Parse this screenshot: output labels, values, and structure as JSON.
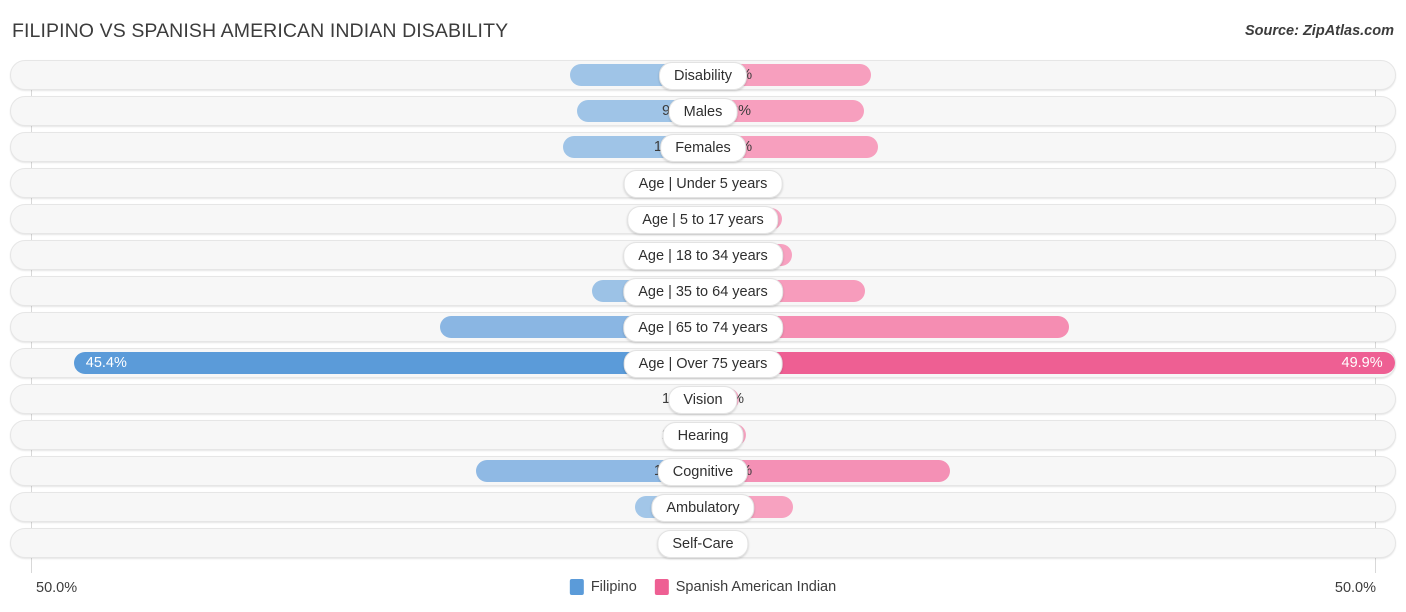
{
  "header": {
    "title": "FILIPINO VS SPANISH AMERICAN INDIAN DISABILITY",
    "source": "Source: ZipAtlas.com"
  },
  "axis": {
    "left_label": "50.0%",
    "right_label": "50.0%"
  },
  "legend": {
    "items": [
      {
        "label": "Filipino",
        "color": "#5b9bd9"
      },
      {
        "label": "Spanish American Indian",
        "color": "#ee5f93"
      }
    ]
  },
  "chart_data": {
    "type": "bar",
    "title": "FILIPINO VS SPANISH AMERICAN INDIAN DISABILITY",
    "subtitle": "Source: ZipAtlas.com",
    "orientation": "horizontal-diverging",
    "xlabel": "",
    "ylabel": "",
    "xlim": [
      -50.0,
      50.0
    ],
    "axis_left_label": "50.0%",
    "axis_right_label": "50.0%",
    "grid": true,
    "legend_position": "bottom-center",
    "categories": [
      "Disability",
      "Males",
      "Females",
      "Age | Under 5 years",
      "Age | 5 to 17 years",
      "Age | 18 to 34 years",
      "Age | 35 to 64 years",
      "Age | 65 to 74 years",
      "Age | Over 75 years",
      "Vision",
      "Hearing",
      "Cognitive",
      "Ambulatory",
      "Self-Care"
    ],
    "series": [
      {
        "name": "Filipino",
        "color": "#5b9bd9",
        "values": [
          9.6,
          9.1,
          10.1,
          1.1,
          4.3,
          5.4,
          8.0,
          19.0,
          45.4,
          1.7,
          2.6,
          16.4,
          4.9,
          2.2
        ]
      },
      {
        "name": "Spanish American Indian",
        "color": "#ee5f93",
        "values": [
          12.1,
          11.6,
          12.6,
          1.3,
          5.7,
          6.4,
          11.7,
          26.4,
          49.9,
          2.6,
          3.1,
          17.8,
          6.5,
          2.9
        ]
      }
    ],
    "rows": [
      {
        "label": "Disability",
        "left_value": 9.6,
        "right_value": 12.1,
        "left_text": "9.6%",
        "right_text": "12.1%",
        "left_color": "#9fc4e7",
        "right_color": "#f79fbe",
        "emphasis": false
      },
      {
        "label": "Males",
        "left_value": 9.1,
        "right_value": 11.6,
        "left_text": "9.1%",
        "right_text": "11.6%",
        "left_color": "#9fc4e7",
        "right_color": "#f79fbe",
        "emphasis": false
      },
      {
        "label": "Females",
        "left_value": 10.1,
        "right_value": 12.6,
        "left_text": "10.1%",
        "right_text": "12.6%",
        "left_color": "#9fc4e7",
        "right_color": "#f79fbe",
        "emphasis": false
      },
      {
        "label": "Age | Under 5 years",
        "left_value": 1.1,
        "right_value": 1.3,
        "left_text": "1.1%",
        "right_text": "1.3%",
        "left_color": "#a8cbeb",
        "right_color": "#f8a8c4",
        "emphasis": false
      },
      {
        "label": "Age | 5 to 17 years",
        "left_value": 4.3,
        "right_value": 5.7,
        "left_text": "4.3%",
        "right_text": "5.7%",
        "left_color": "#a3c7e9",
        "right_color": "#f7a3c1",
        "emphasis": false
      },
      {
        "label": "Age | 18 to 34 years",
        "left_value": 5.4,
        "right_value": 6.4,
        "left_text": "5.4%",
        "right_text": "6.4%",
        "left_color": "#a1c5e8",
        "right_color": "#f7a1c0",
        "emphasis": false
      },
      {
        "label": "Age | 35 to 64 years",
        "left_value": 8.0,
        "right_value": 11.7,
        "left_text": "8.0%",
        "right_text": "11.7%",
        "left_color": "#9cc2e6",
        "right_color": "#f79cbc",
        "emphasis": false
      },
      {
        "label": "Age | 65 to 74 years",
        "left_value": 19.0,
        "right_value": 26.4,
        "left_text": "19.0%",
        "right_text": "26.4%",
        "left_color": "#8ab6e3",
        "right_color": "#f58db2",
        "emphasis": false
      },
      {
        "label": "Age | Over 75 years",
        "left_value": 45.4,
        "right_value": 49.9,
        "left_text": "45.4%",
        "right_text": "49.9%",
        "left_color": "#5b9bd9",
        "right_color": "#ee5f93",
        "emphasis": true
      },
      {
        "label": "Vision",
        "left_value": 1.7,
        "right_value": 2.6,
        "left_text": "1.7%",
        "right_text": "2.6%",
        "left_color": "#a6c9ea",
        "right_color": "#f8a6c3",
        "emphasis": false
      },
      {
        "label": "Hearing",
        "left_value": 2.6,
        "right_value": 3.1,
        "left_text": "2.6%",
        "right_text": "3.1%",
        "left_color": "#a5c8ea",
        "right_color": "#f7a5c2",
        "emphasis": false
      },
      {
        "label": "Cognitive",
        "left_value": 16.4,
        "right_value": 17.8,
        "left_text": "16.4%",
        "right_text": "17.8%",
        "left_color": "#8fb9e4",
        "right_color": "#f490b5",
        "emphasis": false
      },
      {
        "label": "Ambulatory",
        "left_value": 4.9,
        "right_value": 6.5,
        "left_text": "4.9%",
        "right_text": "6.5%",
        "left_color": "#a2c6e8",
        "right_color": "#f7a2c0",
        "emphasis": false
      },
      {
        "label": "Self-Care",
        "left_value": 2.2,
        "right_value": 2.9,
        "left_text": "2.2%",
        "right_text": "2.9%",
        "left_color": "#a6c9ea",
        "right_color": "#f8a6c3",
        "emphasis": false
      }
    ]
  }
}
